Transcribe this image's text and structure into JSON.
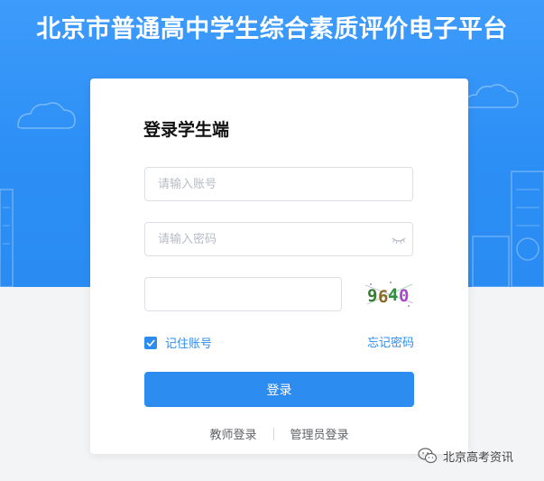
{
  "header": {
    "title": "北京市普通高中学生综合素质评价电子平台"
  },
  "login": {
    "title": "登录学生端",
    "account_placeholder": "请输入账号",
    "password_placeholder": "请输入密码",
    "captcha_value": "",
    "captcha_image_text": "9640",
    "remember_label": "记住账号",
    "remember_checked": true,
    "forgot_label": "忘记密码",
    "submit_label": "登录"
  },
  "links": {
    "teacher_login": "教师登录",
    "admin_login": "管理员登录"
  },
  "watermark": {
    "text": "北京高考资讯"
  },
  "colors": {
    "hero": "#2c8ff5",
    "accent": "#2d8cf0",
    "background": "#f3f4f6"
  },
  "icons": {
    "password_toggle": "eye-closed-icon",
    "checkbox": "check-icon",
    "watermark": "wechat-icon"
  }
}
